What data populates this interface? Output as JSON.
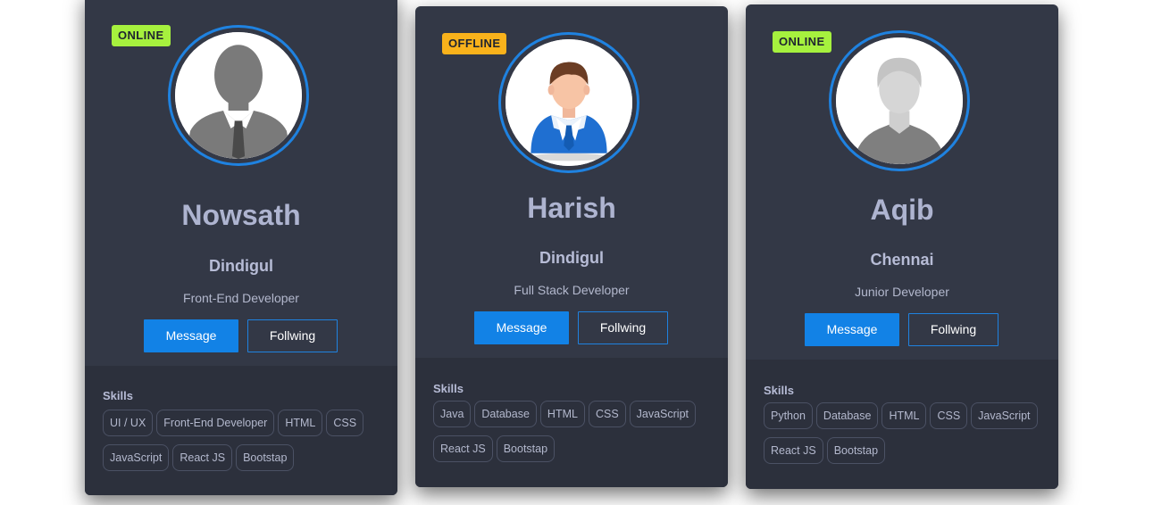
{
  "colors": {
    "card_bg": "#333846",
    "skills_bg": "#2c303c",
    "accent": "#1282e6",
    "online": "#a6f13e",
    "offline": "#f9b21b"
  },
  "cards": [
    {
      "status": "ONLINE",
      "status_color": "#a6f13e",
      "avatar_icon": "user-silhouette-tie-icon",
      "name": "Nowsath",
      "city": "Dindigul",
      "role": "Front-End Developer",
      "message_label": "Message",
      "following_label": "Follwing",
      "skills_title": "Skills",
      "skills": [
        "UI / UX",
        "Front-End Developer",
        "HTML",
        "CSS",
        "JavaScript",
        "React JS",
        "Bootstap"
      ]
    },
    {
      "status": "OFFLINE",
      "status_color": "#f9b21b",
      "avatar_icon": "businessman-avatar-icon",
      "name": "Harish",
      "city": "Dindigul",
      "role": "Full Stack Developer",
      "message_label": "Message",
      "following_label": "Follwing",
      "skills_title": "Skills",
      "skills": [
        "Java",
        "Database",
        "HTML",
        "CSS",
        "JavaScript",
        "React JS",
        "Bootstap"
      ]
    },
    {
      "status": "ONLINE",
      "status_color": "#a6f13e",
      "avatar_icon": "user-silhouette-grey-icon",
      "name": "Aqib",
      "city": "Chennai",
      "role": "Junior Developer",
      "message_label": "Message",
      "following_label": "Follwing",
      "skills_title": "Skills",
      "skills": [
        "Python",
        "Database",
        "HTML",
        "CSS",
        "JavaScript",
        "React JS",
        "Bootstap"
      ]
    }
  ]
}
